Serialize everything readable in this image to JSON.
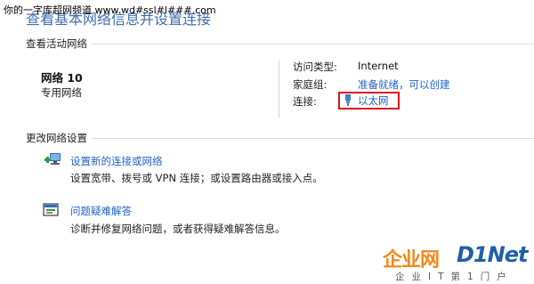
{
  "watermark_top": "你的一字库超网频道 www.wd#ssl#l###.com",
  "page_title": "查看基本网络信息并设置连接",
  "active_networks": {
    "header": "查看活动网络",
    "network_name": "网络 10",
    "network_type": "专用网络",
    "access_type_label": "访问类型:",
    "access_type_value": "Internet",
    "homegroup_label": "家庭组:",
    "homegroup_value": "准备就绪，可以创建",
    "connections_label": "连接:",
    "connections_value": "以太网"
  },
  "change_settings": {
    "header": "更改网络设置",
    "items": [
      {
        "icon": "network-setup-icon",
        "title": "设置新的连接或网络",
        "description": "设置宽带、拨号或 VPN 连接；或设置路由器或接入点。"
      },
      {
        "icon": "troubleshoot-icon",
        "title": "问题疑难解答",
        "description": "诊断并修复网络问题，或者获得疑难解答信息。"
      }
    ]
  },
  "watermark_logo": {
    "brand": "企业网",
    "brand2": "D1Net",
    "slogan": "企业IT第1门户"
  },
  "colors": {
    "link": "#1f63c6",
    "highlight_box": "#e0141b",
    "logo_orange": "#f08a1c",
    "logo_blue": "#1e5fa8"
  }
}
